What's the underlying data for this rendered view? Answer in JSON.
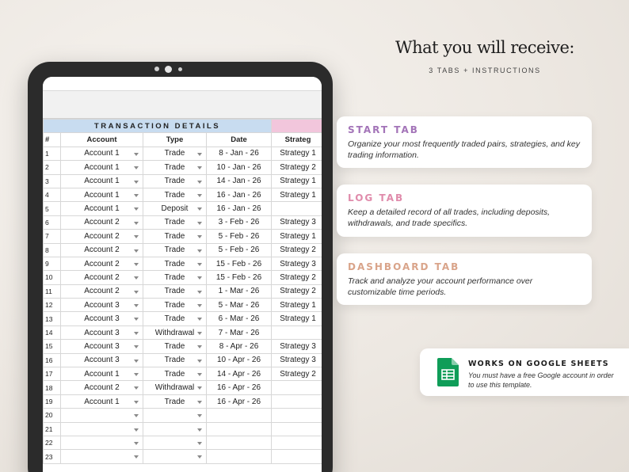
{
  "header": {
    "title": "What you will receive:",
    "subtitle": "3 TABS + INSTRUCTIONS"
  },
  "colors": {
    "start_tab": "#a374b8",
    "log_tab": "#e08bab",
    "dashboard_tab": "#d9a48a",
    "sheet_header_blue": "#c8dcf0",
    "sheet_header_pink": "#f2c6dc",
    "google_sheets_green": "#0f9d58"
  },
  "cards": [
    {
      "title": "START TAB",
      "description": "Organize your most frequently traded pairs, strategies, and key trading information."
    },
    {
      "title": "LOG TAB",
      "description": "Keep a detailed record of all trades, including deposits, withdrawals, and trade specifics."
    },
    {
      "title": "DASHBOARD TAB",
      "description": "Track and analyze your account performance over customizable time periods."
    }
  ],
  "google_sheets": {
    "icon": "google-sheets-icon",
    "title": "WORKS ON GOOGLE SHEETS",
    "description": "You must have a free Google account in order to use this template."
  },
  "sheet": {
    "section_title": "TRANSACTION DETAILS",
    "columns": [
      "#",
      "Account",
      "Type",
      "Date",
      "Strateg"
    ],
    "rows": [
      {
        "n": "1",
        "account": "Account 1",
        "type": "Trade",
        "date": "8 - Jan - 26",
        "strategy": "Strategy 1"
      },
      {
        "n": "2",
        "account": "Account 1",
        "type": "Trade",
        "date": "10 - Jan - 26",
        "strategy": "Strategy 2"
      },
      {
        "n": "3",
        "account": "Account 1",
        "type": "Trade",
        "date": "14 - Jan - 26",
        "strategy": "Strategy 1"
      },
      {
        "n": "4",
        "account": "Account 1",
        "type": "Trade",
        "date": "16 - Jan - 26",
        "strategy": "Strategy 1"
      },
      {
        "n": "5",
        "account": "Account 1",
        "type": "Deposit",
        "date": "16 - Jan - 26",
        "strategy": ""
      },
      {
        "n": "6",
        "account": "Account 2",
        "type": "Trade",
        "date": "3 - Feb - 26",
        "strategy": "Strategy 3"
      },
      {
        "n": "7",
        "account": "Account 2",
        "type": "Trade",
        "date": "5 - Feb - 26",
        "strategy": "Strategy 1"
      },
      {
        "n": "8",
        "account": "Account 2",
        "type": "Trade",
        "date": "5 - Feb - 26",
        "strategy": "Strategy 2"
      },
      {
        "n": "9",
        "account": "Account 2",
        "type": "Trade",
        "date": "15 - Feb - 26",
        "strategy": "Strategy 3"
      },
      {
        "n": "10",
        "account": "Account 2",
        "type": "Trade",
        "date": "15 - Feb - 26",
        "strategy": "Strategy 2"
      },
      {
        "n": "11",
        "account": "Account 2",
        "type": "Trade",
        "date": "1 - Mar - 26",
        "strategy": "Strategy 2"
      },
      {
        "n": "12",
        "account": "Account 3",
        "type": "Trade",
        "date": "5 - Mar - 26",
        "strategy": "Strategy 1"
      },
      {
        "n": "13",
        "account": "Account 3",
        "type": "Trade",
        "date": "6 - Mar - 26",
        "strategy": "Strategy 1"
      },
      {
        "n": "14",
        "account": "Account 3",
        "type": "Withdrawal",
        "date": "7 - Mar - 26",
        "strategy": ""
      },
      {
        "n": "15",
        "account": "Account 3",
        "type": "Trade",
        "date": "8 - Apr - 26",
        "strategy": "Strategy 3"
      },
      {
        "n": "16",
        "account": "Account 3",
        "type": "Trade",
        "date": "10 - Apr - 26",
        "strategy": "Strategy 3"
      },
      {
        "n": "17",
        "account": "Account 1",
        "type": "Trade",
        "date": "14 - Apr - 26",
        "strategy": "Strategy 2"
      },
      {
        "n": "18",
        "account": "Account 2",
        "type": "Withdrawal",
        "date": "16 - Apr - 26",
        "strategy": ""
      },
      {
        "n": "19",
        "account": "Account 1",
        "type": "Trade",
        "date": "16 - Apr - 26",
        "strategy": ""
      },
      {
        "n": "20",
        "account": "",
        "type": "",
        "date": "",
        "strategy": ""
      },
      {
        "n": "21",
        "account": "",
        "type": "",
        "date": "",
        "strategy": ""
      },
      {
        "n": "22",
        "account": "",
        "type": "",
        "date": "",
        "strategy": ""
      },
      {
        "n": "23",
        "account": "",
        "type": "",
        "date": "",
        "strategy": ""
      }
    ]
  }
}
